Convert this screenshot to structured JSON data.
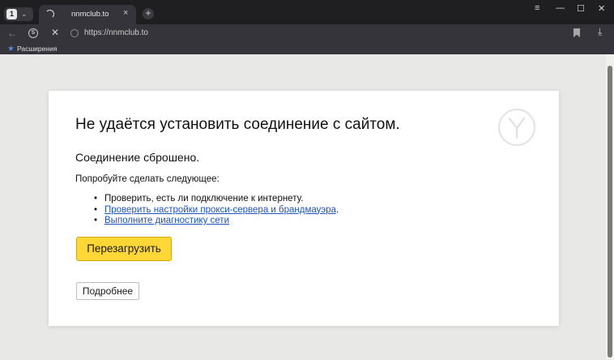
{
  "browser": {
    "tabs_count": "1",
    "tab": {
      "title": "nnmclub.to",
      "close_symbol": "×"
    },
    "new_tab_symbol": "+",
    "url": "https://nnmclub.to",
    "bookmarks_bar": {
      "extensions_label": "Расширения"
    },
    "window_controls": {
      "menu": "≡",
      "minimize": "—",
      "maximize": "☐",
      "close": "✕"
    }
  },
  "error_page": {
    "title": "Не удаётся установить соединение с сайтом.",
    "subtitle": "Соединение сброшено.",
    "hint": "Попробуйте сделать следующее:",
    "suggestions": [
      {
        "text": "Проверить, есть ли подключение к интернету.",
        "is_link": false
      },
      {
        "text": "Проверить настройки прокси-сервера и брандмауэра",
        "suffix": ".",
        "is_link": true
      },
      {
        "text": "Выполните диагностику сети",
        "is_link": true
      }
    ],
    "reload_button": "Перезагрузить",
    "details_button": "Подробнее"
  },
  "colors": {
    "browser_chrome": "#1f1f22",
    "toolbar": "#34343a",
    "page_background": "#e8e8e6",
    "reload_button": "#ffd737",
    "link": "#1a55c8"
  },
  "icons": [
    "tabs-count-icon",
    "spinner-icon",
    "close-icon",
    "plus-icon",
    "back-arrow-icon",
    "protect-icon",
    "stop-icon",
    "site-icon",
    "bookmark-icon",
    "download-icon",
    "star-icon",
    "yandex-logo-icon"
  ]
}
